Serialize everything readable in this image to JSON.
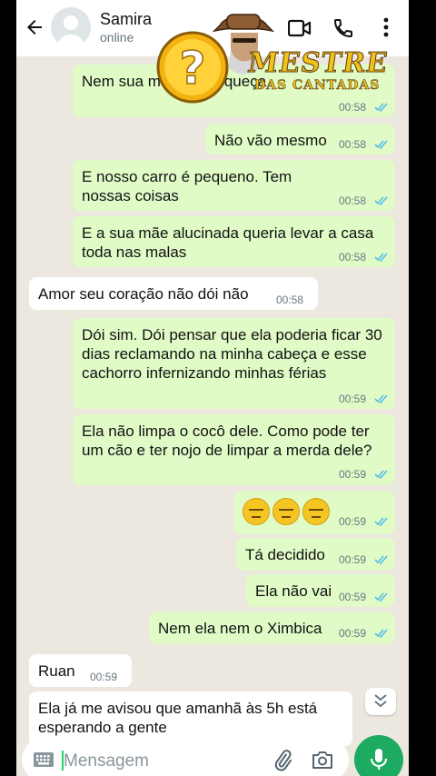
{
  "contact": {
    "name": "Samira",
    "status": "online"
  },
  "logo": {
    "text_main": "MESTRE",
    "text_sub": "DAS CANTADAS"
  },
  "messages": [
    {
      "dir": "out",
      "text": "Nem sua m a não esqueça",
      "time": "00:58",
      "ticks": "read"
    },
    {
      "dir": "out",
      "text": "Não vão mesmo",
      "time": "00:58",
      "ticks": "read"
    },
    {
      "dir": "out",
      "text": "E nosso carro é pequeno. Tem nossas coisas",
      "time": "00:58",
      "ticks": "read"
    },
    {
      "dir": "out",
      "text": "E a sua mãe alucinada queria levar a casa toda nas malas",
      "time": "00:58",
      "ticks": "read"
    },
    {
      "dir": "in",
      "text": "Amor seu coração não dói não",
      "time": "00:58"
    },
    {
      "dir": "out",
      "text": "Dói sim. Dói pensar que ela poderia ficar 30 dias reclamando na minha cabeça e esse cachorro infernizando minhas férias",
      "time": "00:59",
      "ticks": "read"
    },
    {
      "dir": "out",
      "text": "Ela não limpa o cocô dele. Como pode ter um cão e ter nojo de limpar a merda dele?",
      "time": "00:59",
      "ticks": "read"
    },
    {
      "dir": "out",
      "text": "",
      "emoji": [
        "expressionless-face",
        "expressionless-face",
        "expressionless-face"
      ],
      "time": "00:59",
      "ticks": "read"
    },
    {
      "dir": "out",
      "text": "Tá decidido",
      "time": "00:59",
      "ticks": "read"
    },
    {
      "dir": "out",
      "text": "Ela não vai",
      "time": "00:59",
      "ticks": "read"
    },
    {
      "dir": "out",
      "text": "Nem ela nem o Ximbica",
      "time": "00:59",
      "ticks": "read"
    },
    {
      "dir": "in",
      "text": "Ruan",
      "time": "00:59"
    },
    {
      "dir": "in",
      "text": "Ela já me avisou que amanhã às 5h está esperando a gente"
    }
  ],
  "composer": {
    "placeholder": "Mensagem"
  },
  "colors": {
    "outgoing": "#e1fbc7",
    "incoming": "#ffffff",
    "read_ticks": "#53bdeb",
    "accent": "#1daa61",
    "background": "#ece7df"
  },
  "icons": [
    "back-arrow-icon",
    "avatar-placeholder-icon",
    "video-call-icon",
    "phone-icon",
    "more-vert-icon",
    "scroll-down-icon",
    "keyboard-icon",
    "attach-icon",
    "camera-icon",
    "mic-icon"
  ]
}
